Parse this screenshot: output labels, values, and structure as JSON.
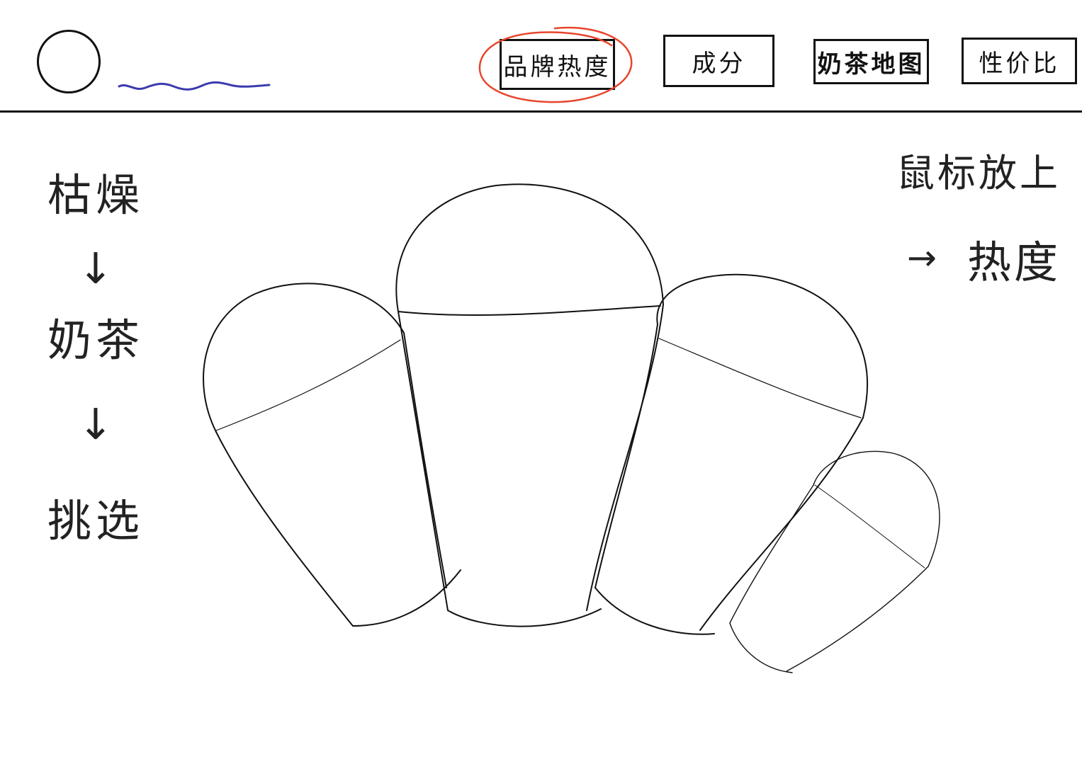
{
  "header": {
    "nav": [
      {
        "label": "品牌热度",
        "selected": true
      },
      {
        "label": "成分",
        "selected": false
      },
      {
        "label": "奶茶地图",
        "selected": false
      },
      {
        "label": "性价比",
        "selected": false
      }
    ],
    "highlight_color": "#e8452c",
    "squiggle_color": "#3b3bb0"
  },
  "flow": {
    "step1": "枯燥",
    "arrow": "↓",
    "step2": "奶茶",
    "step3": "挑选"
  },
  "hint": {
    "line1": "鼠标放上",
    "arrow": "→",
    "line2": "热度"
  },
  "cups": [
    {
      "name": "cup-1"
    },
    {
      "name": "cup-2"
    },
    {
      "name": "cup-3"
    },
    {
      "name": "cup-4"
    }
  ]
}
